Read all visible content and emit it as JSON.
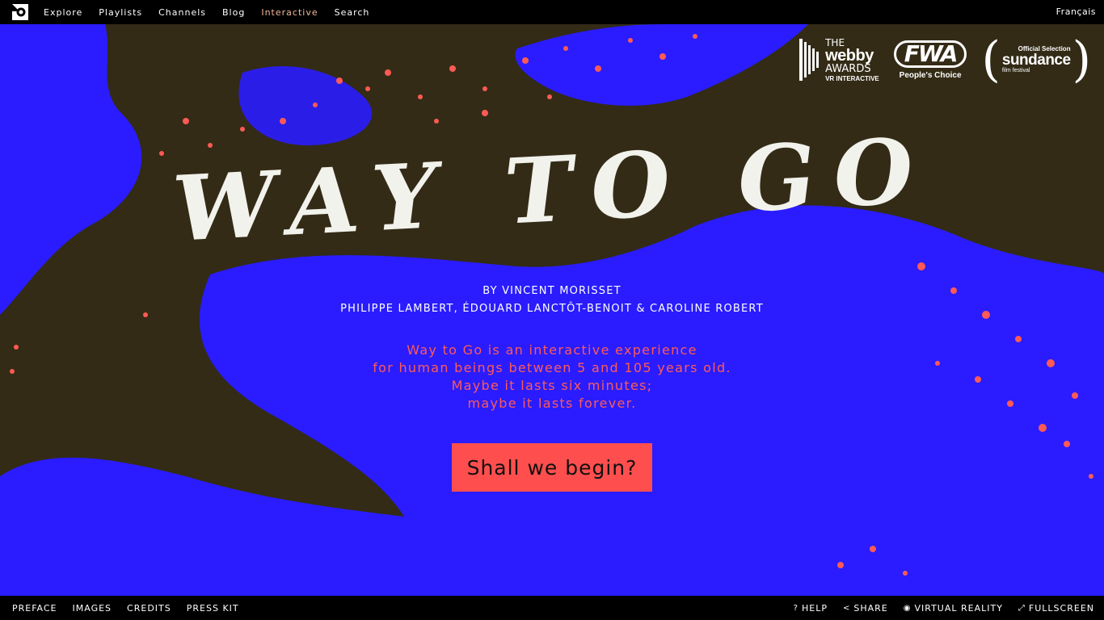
{
  "topnav": {
    "logo_icon": "onf-logo-icon",
    "items": [
      {
        "label": "Explore",
        "active": false
      },
      {
        "label": "Playlists",
        "active": false
      },
      {
        "label": "Channels",
        "active": false
      },
      {
        "label": "Blog",
        "active": false
      },
      {
        "label": "Interactive",
        "active": true
      },
      {
        "label": "Search",
        "active": false
      }
    ],
    "language": "Français"
  },
  "awards": {
    "webby": {
      "line1": "THE",
      "line2": "webby",
      "line3": "AWARDS",
      "line4": "VR INTERACTIVE"
    },
    "fwa": {
      "mark": "FWA",
      "caption": "People's Choice"
    },
    "sundance": {
      "top": "Official Selection",
      "name": "sundance",
      "sub": "film festival"
    }
  },
  "hero": {
    "title": "WAY TO GO",
    "byline": "BY VINCENT MORISSET",
    "credits": "PHILIPPE LAMBERT, ÉDOUARD LANCTÔT-BENOIT & CAROLINE ROBERT",
    "blurb": [
      "Way to Go is an interactive experience",
      "for human beings between 5 and 105 years old.",
      "Maybe it lasts six minutes;",
      "maybe it lasts forever."
    ],
    "cta": "Shall we begin?"
  },
  "colors": {
    "background": "#332b16",
    "blue": "#2a1cff",
    "coral": "#ff5a55",
    "cta": "#ff4e4e",
    "active_nav": "#f2b89a"
  },
  "bottombar": {
    "left": [
      "PREFACE",
      "IMAGES",
      "CREDITS",
      "PRESS KIT"
    ],
    "right": [
      {
        "label": "HELP",
        "icon": "?"
      },
      {
        "label": "SHARE",
        "icon": "<"
      },
      {
        "label": "VIRTUAL REALITY",
        "icon": "◉"
      },
      {
        "label": "FULLSCREEN",
        "icon": "⤢"
      }
    ]
  }
}
